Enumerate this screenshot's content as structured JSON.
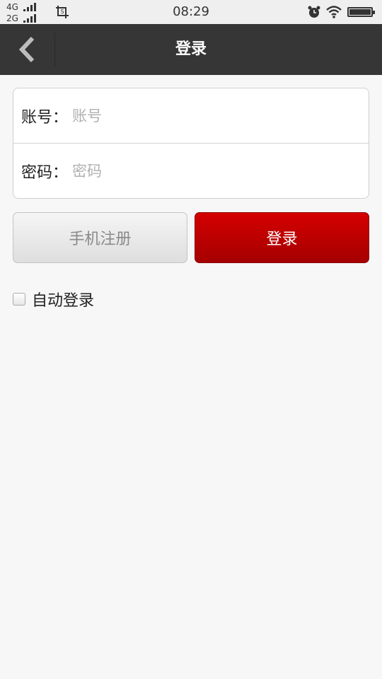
{
  "status_bar": {
    "network_top": "4G",
    "network_bottom": "2G",
    "time": "08:29",
    "icons": [
      "signal-icon",
      "screenshot-icon",
      "alarm-icon",
      "wifi-icon",
      "battery-icon"
    ]
  },
  "nav": {
    "title": "登录",
    "back_icon": "chevron-left-icon"
  },
  "form": {
    "account_label": "账号：",
    "account_placeholder": "账号",
    "account_value": "",
    "password_label": "密码：",
    "password_placeholder": "密码",
    "password_value": ""
  },
  "buttons": {
    "register_label": "手机注册",
    "login_label": "登录"
  },
  "auto_login": {
    "label": "自动登录",
    "checked": false
  },
  "colors": {
    "nav_background": "#363636",
    "login_button": "#c40000",
    "page_background": "#f7f7f7"
  }
}
